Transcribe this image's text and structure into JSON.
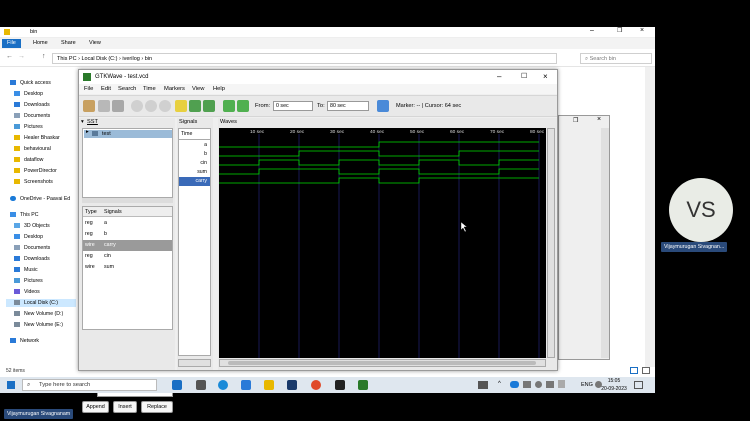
{
  "explorer": {
    "title": "bin",
    "ribbon_tabs": [
      "File",
      "Home",
      "Share",
      "View"
    ],
    "address": [
      "This PC",
      "Local Disk (C:)",
      "iverilog",
      "bin"
    ],
    "search_placeholder": "Search bin",
    "nav_items": [
      {
        "label": "Quick access",
        "icon": "star-icon"
      },
      {
        "label": "Desktop",
        "icon": "desktop-icon"
      },
      {
        "label": "Downloads",
        "icon": "download-icon"
      },
      {
        "label": "Documents",
        "icon": "document-icon"
      },
      {
        "label": "Pictures",
        "icon": "picture-icon"
      },
      {
        "label": "Healer Bhaskar",
        "icon": "folder-icon"
      },
      {
        "label": "behavioural",
        "icon": "folder-icon"
      },
      {
        "label": "dataflow",
        "icon": "folder-icon"
      },
      {
        "label": "PowerDirector",
        "icon": "folder-icon"
      },
      {
        "label": "Screenshots",
        "icon": "folder-icon"
      },
      {
        "label": "OneDrive - Paavai Ed",
        "icon": "cloud-icon"
      },
      {
        "label": "This PC",
        "icon": "pc-icon"
      },
      {
        "label": "3D Objects",
        "icon": "cube-icon"
      },
      {
        "label": "Desktop",
        "icon": "desktop-icon"
      },
      {
        "label": "Documents",
        "icon": "document-icon"
      },
      {
        "label": "Downloads",
        "icon": "download-icon"
      },
      {
        "label": "Music",
        "icon": "music-icon"
      },
      {
        "label": "Pictures",
        "icon": "picture-icon"
      },
      {
        "label": "Videos",
        "icon": "video-icon"
      },
      {
        "label": "Local Disk (C:)",
        "icon": "disk-icon"
      },
      {
        "label": "New Volume (D:)",
        "icon": "disk-icon"
      },
      {
        "label": "New Volume (E:)",
        "icon": "disk-icon"
      },
      {
        "label": "Network",
        "icon": "network-icon"
      }
    ],
    "status": "52 items"
  },
  "gtkwave": {
    "title": "GTKWave - test.vcd",
    "menu": [
      "File",
      "Edit",
      "Search",
      "Time",
      "Markers",
      "View",
      "Help"
    ],
    "from_label": "From:",
    "from_value": "0 sec",
    "to_label": "To:",
    "to_value": "80 sec",
    "marker_text": "Marker: --  |  Cursor: 64 sec",
    "sst_label": "SST",
    "tree_item": "test",
    "type_header": "Type",
    "signals_header": "Signals",
    "signal_list": [
      {
        "type": "reg",
        "name": "a"
      },
      {
        "type": "reg",
        "name": "b"
      },
      {
        "type": "wire",
        "name": "carry"
      },
      {
        "type": "reg",
        "name": "cin"
      },
      {
        "type": "wire",
        "name": "sum"
      }
    ],
    "filter_label": "Filter:",
    "buttons": [
      "Append",
      "Insert",
      "Replace"
    ],
    "signals_pane_label": "Signals",
    "waves_pane_label": "Waves",
    "displayed_signals": [
      "Time",
      "a",
      "b",
      "cin",
      "sum",
      "carry"
    ],
    "time_ticks": [
      "10 sec",
      "20 sec",
      "30 sec",
      "40 sec",
      "50 sec",
      "60 sec",
      "70 sec",
      "80 sec"
    ],
    "waveforms": {
      "a": [
        0,
        0,
        0,
        0,
        1,
        1,
        1,
        1
      ],
      "b": [
        0,
        0,
        1,
        1,
        0,
        0,
        1,
        1
      ],
      "cin": [
        0,
        1,
        0,
        1,
        0,
        1,
        0,
        1
      ],
      "sum": [
        0,
        1,
        1,
        0,
        1,
        0,
        0,
        1
      ],
      "carry": [
        0,
        0,
        0,
        1,
        0,
        1,
        1,
        1
      ]
    },
    "wave_color": "#00e000"
  },
  "participant": {
    "initials": "VS",
    "name": "Vijaymurugan Sivagnan...",
    "full_name": "Vijaymurugan Sivagnanam"
  },
  "taskbar": {
    "search_placeholder": "Type here to search",
    "time": "15:05",
    "date": "20-09-2023",
    "lang": "ENG"
  }
}
